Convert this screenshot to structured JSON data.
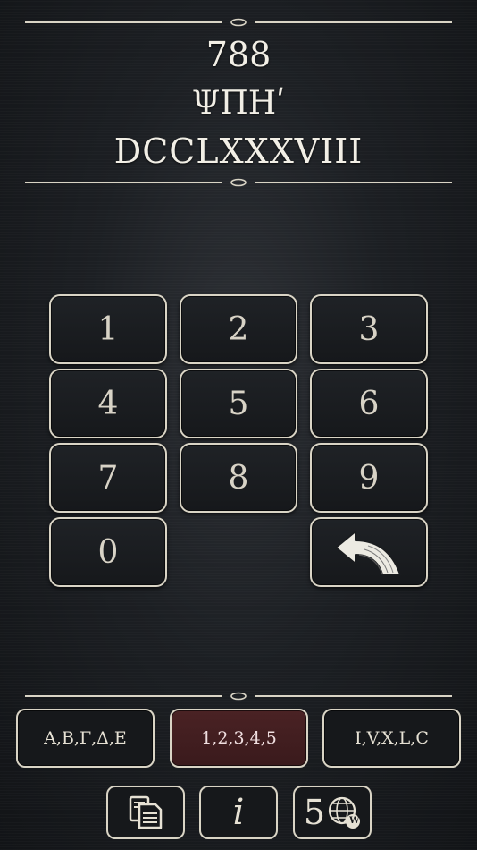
{
  "display": {
    "arabic": "788",
    "greek": "ΨΠΗʹ",
    "roman": "DCCLXXXVIII"
  },
  "keypad": {
    "keys": [
      "1",
      "2",
      "3",
      "4",
      "5",
      "6",
      "7",
      "8",
      "9",
      "0"
    ],
    "backspace_icon": "back-arrow-icon"
  },
  "modes": {
    "greek_label": "Α,Β,Γ,Δ,Ε",
    "arabic_label": "1,2,3,4,5",
    "roman_label": "I,V,X,L,C",
    "selected": "arabic"
  },
  "toolbar": {
    "copy_icon": "copy-icon",
    "info_label": "i",
    "web_number": "5",
    "web_badge": "W",
    "web_icon": "globe-icon"
  },
  "colors": {
    "background": "#1c1f23",
    "border": "#d9d4c5",
    "active_mode": "#4a2224",
    "text": "#ece8de"
  }
}
